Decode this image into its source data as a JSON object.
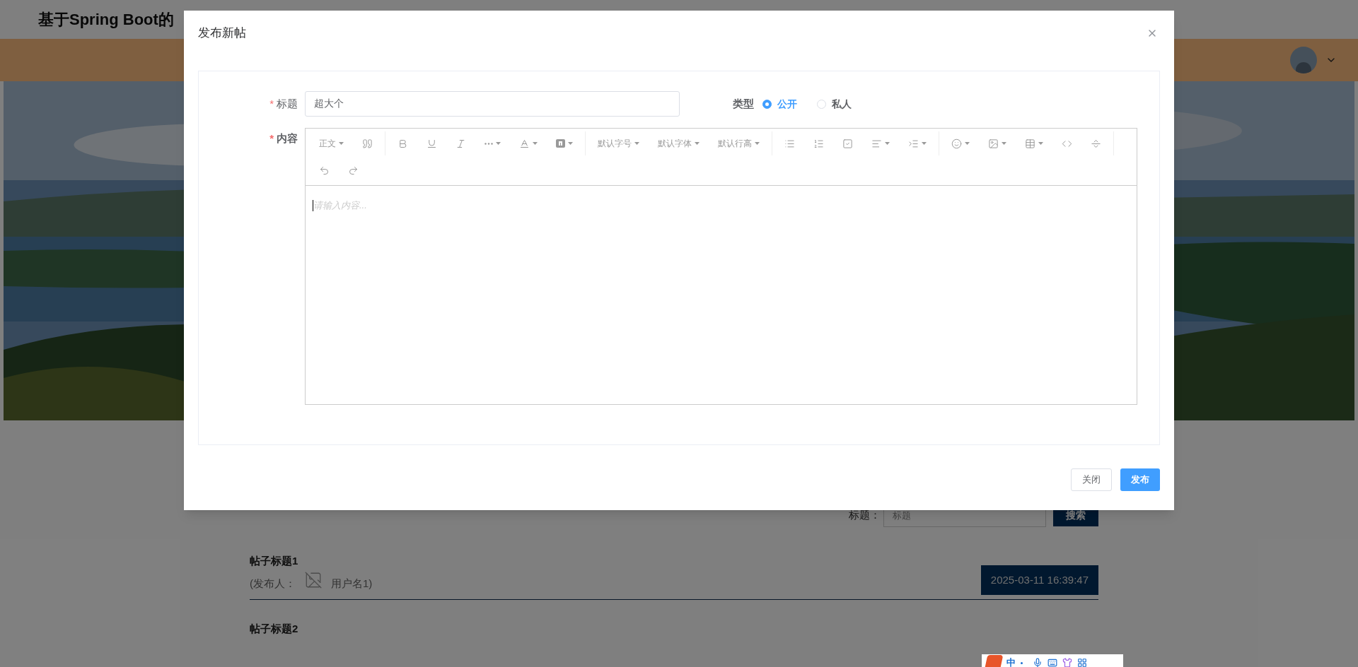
{
  "page": {
    "site_title": "基于Spring Boot的",
    "search": {
      "label": "标题：",
      "placeholder": "标题",
      "button": "搜索"
    },
    "posts": [
      {
        "title": "帖子标题1",
        "prefix": "(发布人：",
        "author": "用户名1)",
        "time": "2025-03-11 16:39:47"
      },
      {
        "title": "帖子标题2"
      }
    ]
  },
  "dialog": {
    "title": "发布新帖",
    "fields": {
      "required_mark": "*",
      "title_label": "标题",
      "title_value": "超大个",
      "type_label": "类型",
      "content_label": "内容"
    },
    "type_options": [
      {
        "label": "公开",
        "selected": true
      },
      {
        "label": "私人",
        "selected": false
      }
    ],
    "toolbar": {
      "block_format": "正文",
      "font_size": "默认字号",
      "font_family": "默认字体",
      "line_height": "默认行高"
    },
    "editor_placeholder": "请输入内容...",
    "buttons": {
      "close": "关闭",
      "publish": "发布"
    }
  },
  "ime_bar": {
    "mode": "中"
  }
}
